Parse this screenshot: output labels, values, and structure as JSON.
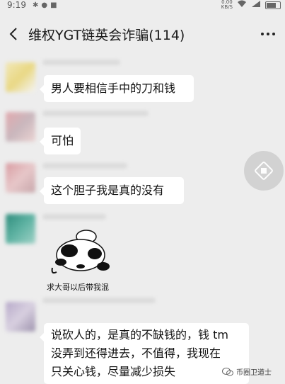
{
  "status": {
    "time": "9:19",
    "net_speed": "0.00",
    "net_unit": "KB/S",
    "battery": ""
  },
  "header": {
    "title": "维权YGT链英会诈骗(114)"
  },
  "messages": [
    {
      "text": "男人要相信手中的刀和钱"
    },
    {
      "text": "可怕"
    },
    {
      "text": "这个胆子我是真的没有"
    },
    {
      "sticker_caption": "求大哥以后带我混"
    },
    {
      "line1": "说砍人的，是真的不缺钱的，钱 tm",
      "line2": "没弄到还得进去，不值得，我现在",
      "line3": "只关心钱，尽量减少损失"
    }
  ],
  "watermark": {
    "text": "币圈卫道士"
  },
  "icons": [
    "back-icon",
    "more-icon",
    "float-window-icon",
    "panda-sticker-icon",
    "wechat-logo-icon"
  ]
}
